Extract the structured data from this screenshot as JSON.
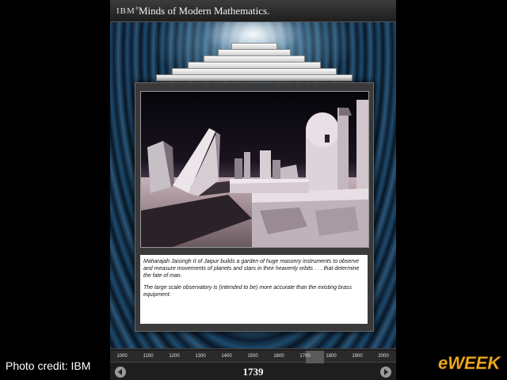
{
  "header": {
    "brand": "IBM",
    "title": "Minds of Modern Mathematics."
  },
  "caption": {
    "p1": "Maharajah Jaisingh II of Jaipur builds a garden of huge masonry instruments to observe and measure movements of planets and stars in their heavenly orbits . . . that determine the fate of man.",
    "p2": "The large scale observatory is (intended to be) more accurate than the existing brass equipment."
  },
  "timeline": {
    "years": [
      "1000",
      "1100",
      "1200",
      "1300",
      "1400",
      "1500",
      "1600",
      "1700",
      "1800",
      "1900",
      "2000"
    ],
    "selected": "1739",
    "prev_icon": "arrow-left-icon",
    "next_icon": "arrow-right-icon"
  },
  "footer": {
    "credit": "Photo credit: IBM",
    "logo": "eWEEK"
  }
}
